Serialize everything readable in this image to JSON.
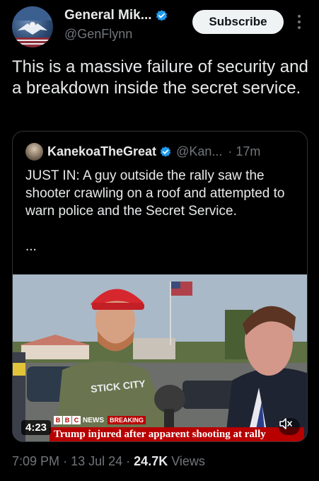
{
  "author": {
    "name": "General Mik...",
    "handle": "@GenFlynn"
  },
  "subscribe_label": "Subscribe",
  "tweet_text": "This is a massive failure of security and a breakdown inside the secret service.",
  "quote": {
    "name": "KanekoaTheGreat",
    "handle": "@Kan...",
    "time": "· 17m",
    "text": "JUST IN: A guy outside the rally saw the shooter crawling on a roof and attempted to warn police and the Secret Service.",
    "ellipsis": "...",
    "video": {
      "duration": "4:23",
      "bbc_letters": [
        "B",
        "B",
        "C"
      ],
      "network": "NEWS",
      "breaking": "BREAKING",
      "headline": "Trump injured after apparent shooting at rally",
      "shirt_text": "STICK CITY"
    }
  },
  "meta": {
    "time": "7:09 PM",
    "date": "13 Jul 24",
    "sep": "·",
    "views_count": "24.7K",
    "views_label": "Views"
  },
  "colors": {
    "background": "#000000",
    "text": "#e7e9ea",
    "muted": "#71767b",
    "verified": "#1d9bf0",
    "bbc_red": "#b80000"
  }
}
